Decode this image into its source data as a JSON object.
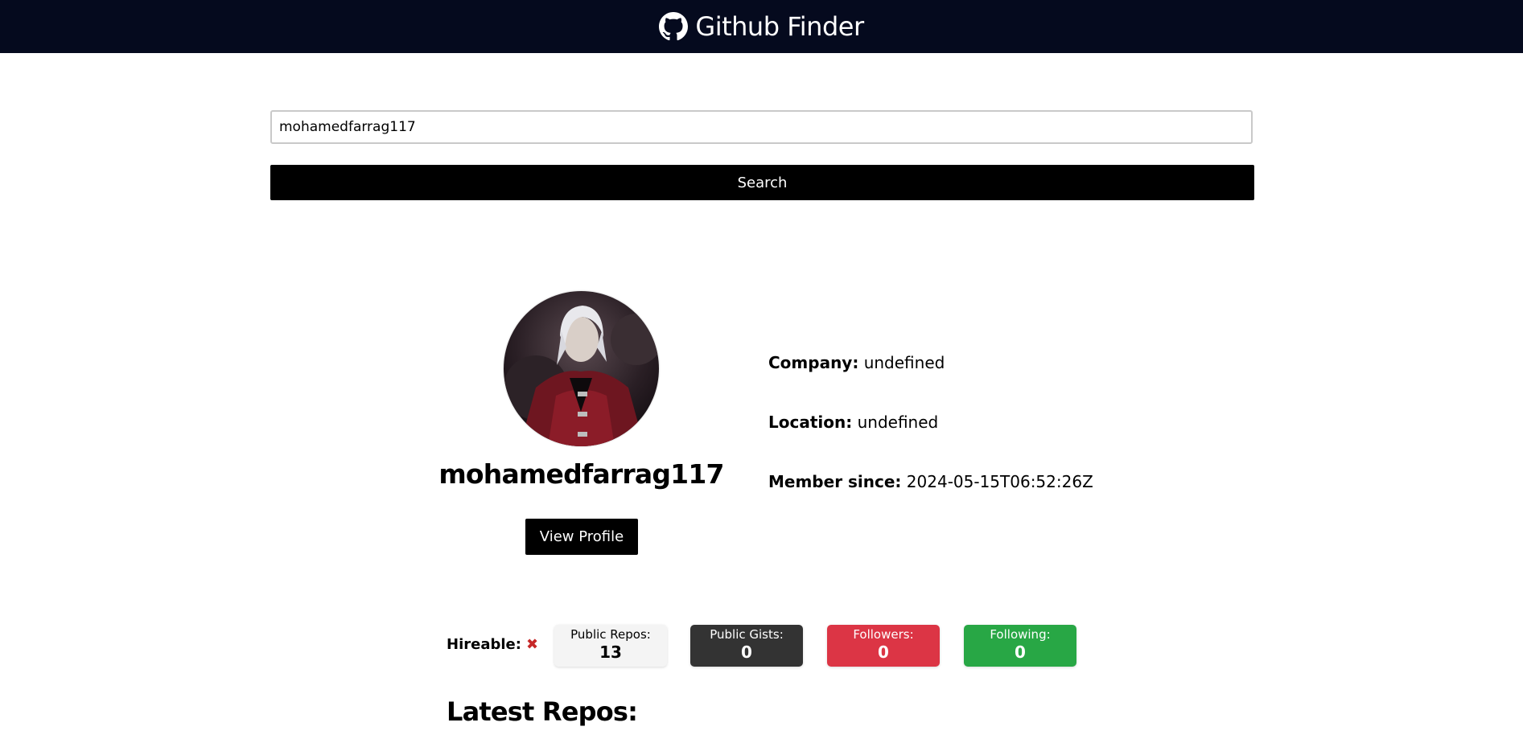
{
  "navbar": {
    "title": "Github Finder",
    "icon": "github-icon",
    "background": "#050a1e"
  },
  "search": {
    "value": "mohamedfarrag117",
    "button_label": "Search"
  },
  "profile": {
    "avatar": "avatar-image",
    "username": "mohamedfarrag117",
    "view_profile_label": "View Profile",
    "company_label": "Company:",
    "company_value": "undefined",
    "location_label": "Location:",
    "location_value": "undefined",
    "member_since_label": "Member since:",
    "member_since_value": "2024-05-15T06:52:26Z"
  },
  "stats": {
    "hireable_label": "Hireable:",
    "hireable_icon": "cross-mark-icon",
    "hireable_glyph": "✖",
    "public_repos_label": "Public Repos:",
    "public_repos_value": "13",
    "public_gists_label": "Public Gists:",
    "public_gists_value": "0",
    "followers_label": "Followers:",
    "followers_value": "0",
    "following_label": "Following:",
    "following_value": "0",
    "colors": {
      "repos": "#f4f4f4",
      "gists": "#333333",
      "followers": "#dc3545",
      "following": "#28a745"
    }
  },
  "repos": {
    "heading": "Latest Repos:"
  }
}
